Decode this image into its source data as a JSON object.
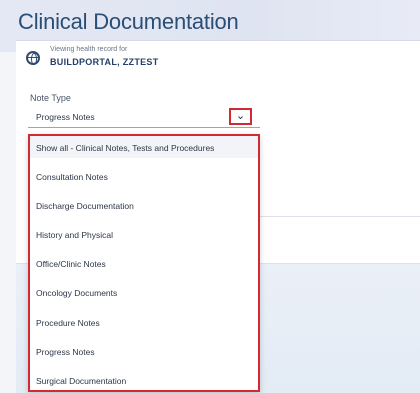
{
  "page": {
    "title": "Clinical Documentation"
  },
  "patient": {
    "viewing_label": "Viewing health record for",
    "name": "BUILDPORTAL, ZZTEST",
    "icon": "globe-icon"
  },
  "note_type": {
    "label": "Note Type",
    "selected": "Progress Notes",
    "dropdown_icon": "chevron-down-icon",
    "options": [
      "Show all - Clinical Notes, Tests and Procedures",
      "Consultation Notes",
      "Discharge Documentation",
      "History and Physical",
      "Office/Clinic Notes",
      "Oncology Documents",
      "Procedure Notes",
      "Progress Notes",
      "Surgical Documentation"
    ]
  },
  "colors": {
    "title": "#2b4e74",
    "highlight_border": "#d22a32",
    "patient_name": "#24406a"
  }
}
